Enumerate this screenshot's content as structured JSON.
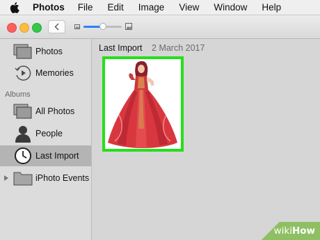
{
  "menubar": {
    "app_name": "Photos",
    "items": [
      "File",
      "Edit",
      "Image",
      "View",
      "Window",
      "Help"
    ]
  },
  "toolbar": {
    "zoom_level": 0.5
  },
  "sidebar": {
    "items": [
      {
        "label": "Photos",
        "icon": "photos-stack-icon"
      },
      {
        "label": "Memories",
        "icon": "memories-icon"
      }
    ],
    "albums_header": "Albums",
    "albums": [
      {
        "label": "All Photos",
        "icon": "photos-stack-icon"
      },
      {
        "label": "People",
        "icon": "person-icon"
      },
      {
        "label": "Last Import",
        "icon": "clock-icon",
        "selected": true
      },
      {
        "label": "iPhoto Events",
        "icon": "folder-icon"
      }
    ]
  },
  "main": {
    "title": "Last Import",
    "date": "2 March 2017"
  },
  "watermark": {
    "wiki": "wiki",
    "how": "How"
  },
  "colors": {
    "selection_highlight": "#25e01b",
    "slider_accent": "#2d7ff9"
  }
}
